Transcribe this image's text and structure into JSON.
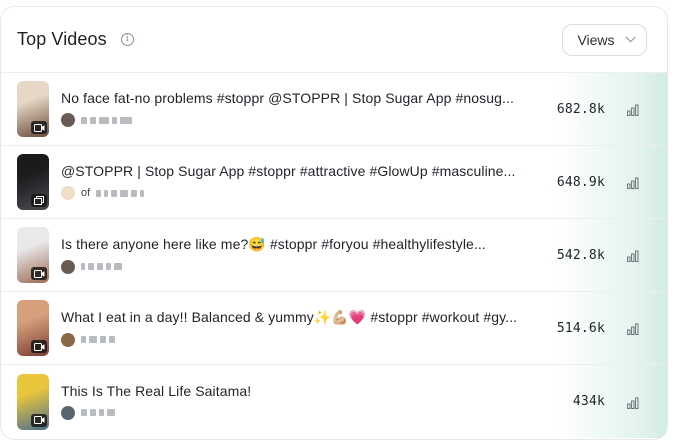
{
  "header": {
    "title": "Top Videos",
    "info_icon": "info-circle-icon",
    "sort_dropdown": {
      "selected": "Views"
    }
  },
  "videos": [
    {
      "title": "No face fat-no problems #stoppr @STOPPR | Stop Sugar App #nosug...",
      "author_prefix": "",
      "views": "682.8k",
      "thumb_colors": [
        "#e6d7c6",
        "#6a4a3a"
      ],
      "avatar_color": "#6b5b55",
      "type": "video"
    },
    {
      "title": "@STOPPR | Stop Sugar App #stoppr #attractive #GlowUp #masculine...",
      "author_prefix": "of",
      "views": "648.9k",
      "thumb_colors": [
        "#1b1b1d",
        "#4a4a52"
      ],
      "avatar_color": "#f0ddc8",
      "type": "carousel"
    },
    {
      "title": "Is there anyone here like me?😅 #stoppr #foryou #healthylifestyle...",
      "author_prefix": "",
      "views": "542.8k",
      "thumb_colors": [
        "#e9e9ec",
        "#9c6a52"
      ],
      "avatar_color": "#6b5b55",
      "type": "video"
    },
    {
      "title": "What I eat in a day!! Balanced & yummy✨💪🏼💗 #stoppr #workout #gy...",
      "author_prefix": "",
      "views": "514.6k",
      "thumb_colors": [
        "#d7a07c",
        "#7a3d32"
      ],
      "avatar_color": "#8a6a44",
      "type": "video"
    },
    {
      "title": "This Is The Real Life Saitama!",
      "author_prefix": "",
      "views": "434k",
      "thumb_colors": [
        "#e8c53a",
        "#4e6e8e"
      ],
      "avatar_color": "#5a6470",
      "type": "video"
    }
  ],
  "colors": {
    "accent_glow": "#c4e6d7",
    "text": "#1f2328",
    "muted": "#8a9099"
  },
  "icons": {
    "row_stats": "bar-chart-icon",
    "dropdown": "chevron-down-icon"
  }
}
